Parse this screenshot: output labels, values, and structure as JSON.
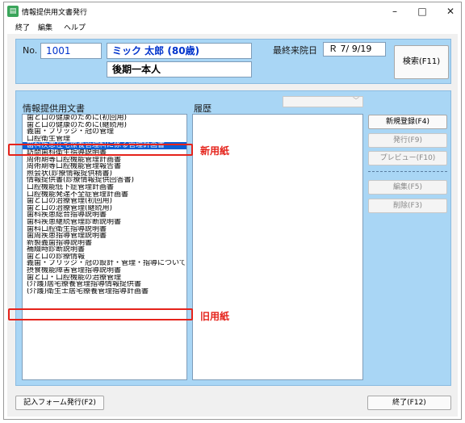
{
  "window": {
    "title": "情報提供用文書発行",
    "app_icon": "document-app-icon",
    "controls": {
      "minimize": "–",
      "maximize": "□",
      "close": "✕"
    }
  },
  "menu": [
    "終了",
    "編集",
    "ヘルプ"
  ],
  "patient": {
    "no_label": "No.",
    "no_value": "1001",
    "name": "ミック 太郎 (80歳)",
    "insurance": "後期一本人",
    "last_visit_label": "最終来院日",
    "last_visit_value": "Ｒ 7/ 9/19"
  },
  "buttons": {
    "search": "検索(F11)",
    "new_register": "新規登録(F4)",
    "issue": "発行(F9)",
    "preview": "プレビュー(F10)",
    "edit": "編集(F5)",
    "delete": "削除(F3)",
    "form_issue": "記入フォーム発行(F2)",
    "exit": "終了(F12)"
  },
  "labels": {
    "documents": "情報提供用文書",
    "history": "履歴"
  },
  "documents": [
    "歯と口の健康のために(初回用)",
    "歯と口の健康のために(継続用)",
    "義歯・ブリッジ・冠の管理",
    "口腔衛生管理",
    "歯科疾患在宅療養管理料に係る管理計画書",
    "訪問歯科衛生指導説明書",
    "周術期等口腔機能管理計画書",
    "周術期等口腔機能管理報告書",
    "照会状(診療情報提供精書)",
    "情報提供書(診療情報提供回答書)",
    "口腔機能低下症管理計画書",
    "口腔機能発達不全症管理計画書",
    "歯と口の治療管理(初回用)",
    "歯と口の治療管理(継続用)",
    "歯科疾患総合指導説明書",
    "歯科疾患継続管理診断説明書",
    "歯科口腔衛生指導説明書",
    "歯周疾患指導管理説明書",
    "新製義歯指導説明書",
    "補綴時診断説明書",
    "歯と口の診療情報",
    "義歯・ブリッジ・冠の設計・管理・指導について",
    "摂食機能障害管理指導説明書",
    "歯と口・口腔機能の治療管理",
    "(介護)居宅療養管理指導情報提供書",
    "(介護)衛生士居宅療養管理指導計画書"
  ],
  "selected_index": 4,
  "annotations": {
    "new_form": "新用紙",
    "old_form": "旧用紙"
  },
  "colors": {
    "panel": "#a9d6f5",
    "selection": "#0b5fd4",
    "annotation_red": "#e5231b",
    "field_text_blue": "#0033cc"
  }
}
